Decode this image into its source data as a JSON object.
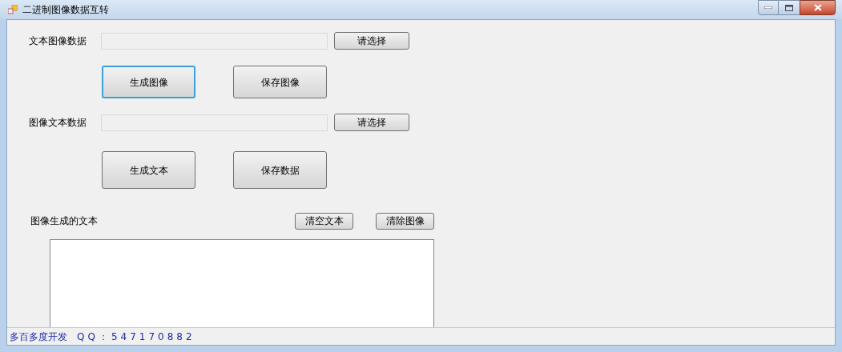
{
  "window": {
    "title": "二进制图像数据互转"
  },
  "sections": [
    {
      "label": "文本图像数据",
      "browse_button": "请选择",
      "actions": [
        {
          "label": "生成图像",
          "focused": true
        },
        {
          "label": "保存图像",
          "focused": false
        }
      ]
    },
    {
      "label": "图像文本数据",
      "browse_button": "请选择",
      "actions": [
        {
          "label": "生成文本",
          "focused": false
        },
        {
          "label": "保存数据",
          "focused": false
        }
      ]
    }
  ],
  "output": {
    "label": "图像生成的文本",
    "buttons": [
      "清空文本",
      "清除图像"
    ]
  },
  "status_bar": {
    "author": "多百多度开发",
    "qq": "QQ：547170882"
  }
}
